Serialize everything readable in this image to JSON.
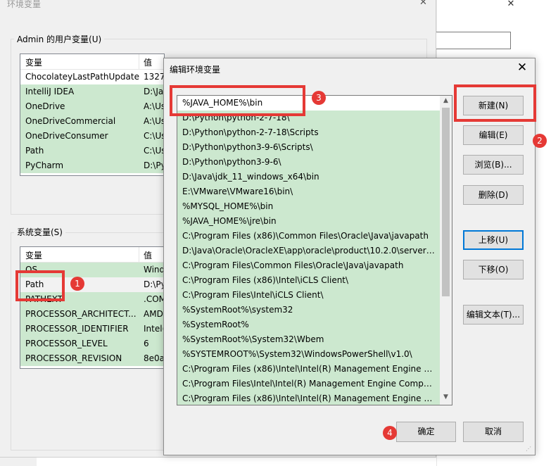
{
  "background_window": {
    "close_glyph": "✕"
  },
  "env_window": {
    "title": "环境变量",
    "close_glyph": "✕",
    "user_group_label": "Admin 的用户变量(U)",
    "system_group_label": "系统变量(S)",
    "col_var": "变量",
    "col_val": "值",
    "user_vars": [
      {
        "name": "ChocolateyLastPathUpdate",
        "value": "1327"
      },
      {
        "name": "IntelliJ IDEA",
        "value": "D:\\Ja"
      },
      {
        "name": "OneDrive",
        "value": "A:\\Us"
      },
      {
        "name": "OneDriveCommercial",
        "value": "A:\\Us"
      },
      {
        "name": "OneDriveConsumer",
        "value": "C:\\Us"
      },
      {
        "name": "Path",
        "value": "C:\\Us"
      },
      {
        "name": "PyCharm",
        "value": "D:\\Py"
      }
    ],
    "system_vars": [
      {
        "name": "OS",
        "value": "Wind"
      },
      {
        "name": "Path",
        "value": "D:\\Py"
      },
      {
        "name": "PATHEXT",
        "value": ".COM"
      },
      {
        "name": "PROCESSOR_ARCHITECT...",
        "value": "AMD"
      },
      {
        "name": "PROCESSOR_IDENTIFIER",
        "value": "Intel("
      },
      {
        "name": "PROCESSOR_LEVEL",
        "value": "6"
      },
      {
        "name": "PROCESSOR_REVISION",
        "value": "8e0a"
      }
    ]
  },
  "edit_dialog": {
    "title": "编辑环境变量",
    "close_glyph": "✕",
    "entries": [
      "%JAVA_HOME%\\bin",
      "D:\\Python\\python-2-7-18\\",
      "D:\\Python\\python-2-7-18\\Scripts",
      "D:\\Python\\python3-9-6\\Scripts\\",
      "D:\\Python\\python3-9-6\\",
      "D:\\Java\\jdk_11_windows_x64\\bin",
      "E:\\VMware\\VMware16\\bin\\",
      "%MYSQL_HOME%\\bin",
      "%JAVA_HOME%\\jre\\bin",
      "C:\\Program Files (x86)\\Common Files\\Oracle\\Java\\javapath",
      "D:\\Java\\Oracle\\OracleXE\\app\\oracle\\product\\10.2.0\\server\\...",
      "C:\\Program Files\\Common Files\\Oracle\\Java\\javapath",
      "C:\\Program Files (x86)\\Intel\\iCLS Client\\",
      "C:\\Program Files\\Intel\\iCLS Client\\",
      "%SystemRoot%\\system32",
      "%SystemRoot%",
      "%SystemRoot%\\System32\\Wbem",
      "%SYSTEMROOT%\\System32\\WindowsPowerShell\\v1.0\\",
      "C:\\Program Files (x86)\\Intel\\Intel(R) Management Engine Co...",
      "C:\\Program Files\\Intel\\Intel(R) Management Engine Compon...",
      "C:\\Program Files (x86)\\Intel\\Intel(R) Management Engine Co..."
    ],
    "buttons": {
      "new": "新建(N)",
      "edit": "编辑(E)",
      "browse": "浏览(B)...",
      "delete": "删除(D)",
      "move_up": "上移(U)",
      "move_down": "下移(O)",
      "edit_text": "编辑文本(T)...",
      "ok": "确定",
      "cancel": "取消"
    },
    "scroll_up_glyph": "▲",
    "scroll_down_glyph": "▼"
  },
  "annotations": {
    "badge_1": "1",
    "badge_2": "2",
    "badge_3": "3",
    "badge_4": "4",
    "color": "#e53935"
  }
}
